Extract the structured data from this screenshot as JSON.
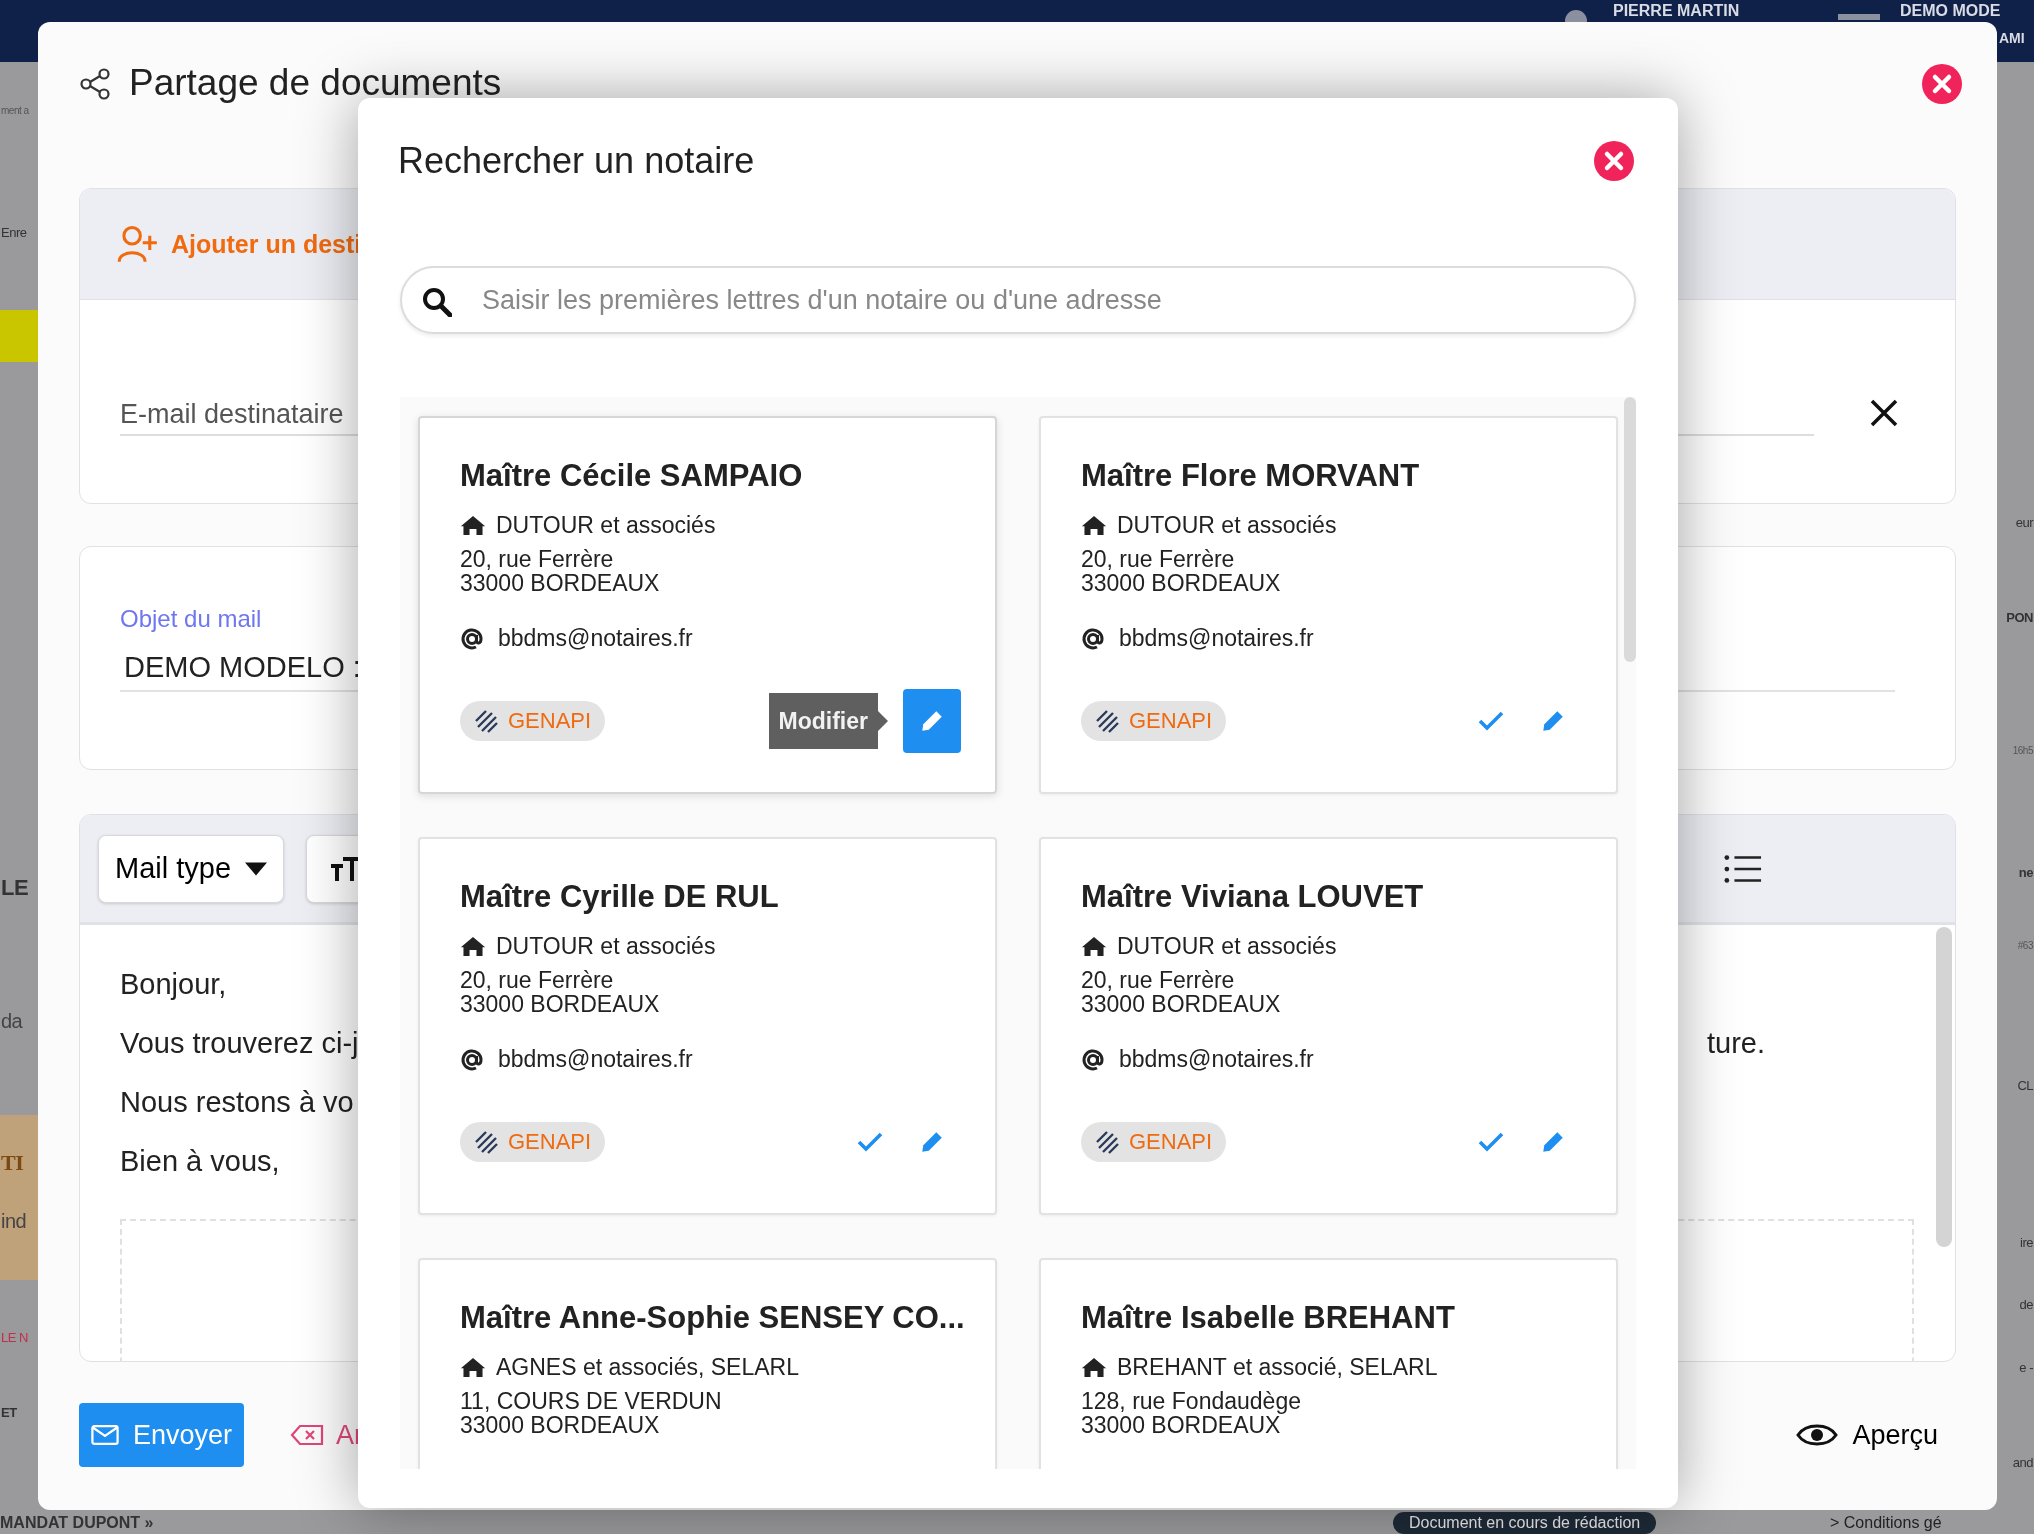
{
  "background": {
    "user": "PIERRE MARTIN",
    "mode": "DEMO MODE",
    "mode_sub": "AMI",
    "left_fragments": [
      {
        "text": "ment a",
        "kind": "small"
      },
      {
        "text": "Enre",
        "kind": "normal"
      },
      {
        "text": "LE",
        "kind": "heading"
      },
      {
        "text": "da",
        "kind": "large"
      },
      {
        "text": "TI",
        "kind": "serif"
      },
      {
        "text": "ind",
        "kind": "large"
      },
      {
        "text": "LE N",
        "kind": "alert"
      },
      {
        "text": "ET",
        "kind": "bold"
      }
    ],
    "right_fragments": [
      {
        "text": "eur",
        "kind": "normal"
      },
      {
        "text": "PON",
        "kind": "bold"
      },
      {
        "text": "16h5",
        "kind": "small"
      },
      {
        "text": "ne",
        "kind": "bold"
      },
      {
        "text": "#63",
        "kind": "small"
      },
      {
        "text": "CL",
        "kind": "normal"
      },
      {
        "text": "ire",
        "kind": "normal"
      },
      {
        "text": "de",
        "kind": "normal"
      },
      {
        "text": "e - ",
        "kind": "normal"
      },
      {
        "text": "and",
        "kind": "normal"
      }
    ],
    "bottom_left": "MANDAT DUPONT »",
    "status_pill": "Document en cours de rédaction",
    "bottom_right": "> Conditions gé"
  },
  "dialog": {
    "title": "Partage de documents",
    "recipients": {
      "add_label": "Ajouter un desti",
      "email_placeholder": "E-mail destinataire"
    },
    "subject": {
      "label": "Objet du mail",
      "value": "DEMO MODELO :"
    },
    "editor": {
      "template_button": "Mail type",
      "lines": [
        {
          "left": "Bonjour,"
        },
        {
          "left": "Vous trouverez ci-j",
          "right": "ture."
        },
        {
          "left": "Nous restons à vo"
        },
        {
          "left": "Bien à vous,"
        }
      ]
    },
    "send_button": "Envoyer",
    "cancel_button": "Ar",
    "preview_button": "Aperçu"
  },
  "modal": {
    "title": "Rechercher un notaire",
    "search": {
      "placeholder": "Saisir les premières lettres d'un notaire ou d'une adresse"
    },
    "notaries": [
      {
        "name": "Maître Cécile SAMPAIO",
        "office": "DUTOUR et associés",
        "address": [
          "20, rue Ferrère",
          "33000 BORDEAUX"
        ],
        "email": "bbdms@notaires.fr",
        "tag": "GENAPI",
        "hovered": true,
        "tooltip": "Modifier"
      },
      {
        "name": "Maître Flore MORVANT",
        "office": "DUTOUR et associés",
        "address": [
          "20, rue Ferrère",
          "33000 BORDEAUX"
        ],
        "email": "bbdms@notaires.fr",
        "tag": "GENAPI",
        "hovered": false
      },
      {
        "name": "Maître Cyrille DE RUL",
        "office": "DUTOUR et associés",
        "address": [
          "20, rue Ferrère",
          "33000 BORDEAUX"
        ],
        "email": "bbdms@notaires.fr",
        "tag": "GENAPI",
        "hovered": false
      },
      {
        "name": "Maître Viviana LOUVET",
        "office": "DUTOUR et associés",
        "address": [
          "20, rue Ferrère",
          "33000 BORDEAUX"
        ],
        "email": "bbdms@notaires.fr",
        "tag": "GENAPI",
        "hovered": false
      },
      {
        "name": "Maître Anne-Sophie SENSEY CO...",
        "office": "AGNES et associés, SELARL",
        "address": [
          "11, COURS DE VERDUN",
          "33000 BORDEAUX"
        ],
        "hovered": false
      },
      {
        "name": "Maître Isabelle BREHANT",
        "office": "BREHANT et associé, SELARL",
        "address": [
          "128, rue Fondaudège",
          "33000 BORDEAUX"
        ],
        "hovered": false
      }
    ]
  }
}
